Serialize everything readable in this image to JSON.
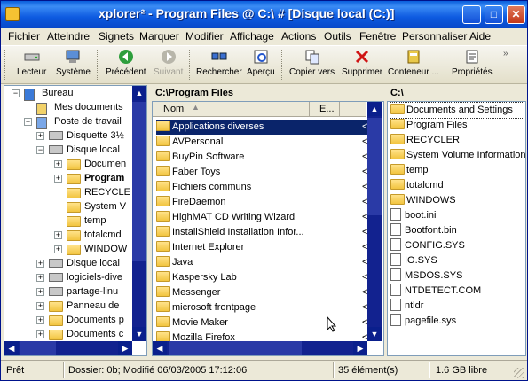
{
  "window": {
    "title": "xplorer² - Program Files @ C:\\ # [Disque local (C:)]"
  },
  "menu": [
    "Fichier",
    "Atteindre",
    "Signets",
    "Marquer",
    "Modifier",
    "Affichage",
    "Actions",
    "Outils",
    "Fenêtre",
    "Personnaliser",
    "Aide"
  ],
  "toolbar": {
    "lecteur": "Lecteur",
    "systeme": "Système",
    "precedent": "Précédent",
    "suivant": "Suivant",
    "rechercher": "Rechercher",
    "apercu": "Aperçu",
    "copier": "Copier vers",
    "supprimer": "Supprimer",
    "conteneur": "Conteneur ...",
    "proprietes": "Propriétés"
  },
  "tree": {
    "items": [
      "Bureau",
      "Mes documents",
      "Poste de travail",
      "Disquette 3½",
      "Disque local",
      "Documen",
      "Program",
      "RECYCLE",
      "System V",
      "temp",
      "totalcmd",
      "WINDOW",
      "Disque local",
      "logiciels-dive",
      "partage-linu",
      "Panneau de",
      "Documents p",
      "Documents c"
    ]
  },
  "middle": {
    "path": "C:\\Program Files",
    "col_name": "Nom",
    "col_ext": "E...",
    "items": [
      "Applications diverses",
      "AVPersonal",
      "BuyPin Software",
      "Faber Toys",
      "Fichiers communs",
      "FireDaemon",
      "HighMAT CD Writing Wizard",
      "InstallShield Installation Infor...",
      "Internet Explorer",
      "Java",
      "Kaspersky Lab",
      "Messenger",
      "microsoft frontpage",
      "Movie Maker",
      "Mozilla Firefox"
    ],
    "ext": "<"
  },
  "right": {
    "path": "C:\\",
    "folders": [
      "Documents and Settings",
      "Program Files",
      "RECYCLER",
      "System Volume Information",
      "temp",
      "totalcmd",
      "WINDOWS"
    ],
    "files": [
      "boot.ini",
      "Bootfont.bin",
      "CONFIG.SYS",
      "IO.SYS",
      "MSDOS.SYS",
      "NTDETECT.COM",
      "ntldr",
      "pagefile.sys"
    ]
  },
  "status": {
    "ready": "Prêt",
    "info": "Dossier: 0b; Modifié 06/03/2005 17:12:06",
    "count": "35 élément(s)",
    "free": "1.6 GB libre"
  }
}
